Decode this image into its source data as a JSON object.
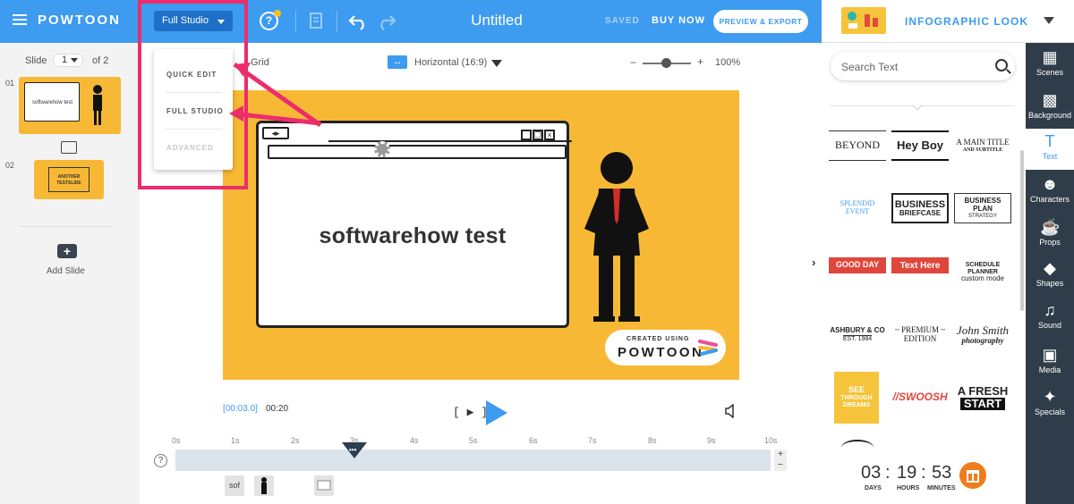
{
  "topbar": {
    "logo": "POWTOON",
    "mode_selected": "Full Studio",
    "title": "Untitled",
    "saved": "SAVED",
    "buy_now": "BUY NOW",
    "preview_export": "PREVIEW & EXPORT",
    "colors": {
      "bar": "#3d9bf0",
      "mode_button": "#1f6fc7",
      "highlight": "#ec2d6b"
    }
  },
  "mode_menu": {
    "items": [
      {
        "label": "QUICK EDIT",
        "enabled": true
      },
      {
        "label": "FULL STUDIO",
        "enabled": true
      },
      {
        "label": "ADVANCED",
        "enabled": false
      }
    ]
  },
  "style_bar": {
    "label": "INFOGRAPHIC LOOK"
  },
  "slides": {
    "label": "Slide",
    "current": "1",
    "of_text": "of 2",
    "items": [
      {
        "number": "01",
        "caption": "softwarehow test"
      },
      {
        "number": "02",
        "caption": "ANOTHER TESTSLIDE",
        "caption_line1": "ANOTHER",
        "caption_line2": "TESTSLIDE"
      }
    ],
    "add_slide": "Add Slide"
  },
  "canvas_toolbar": {
    "grid": "Grid",
    "orientation": "Horizontal (16:9)",
    "zoom": "100%",
    "zoom_minus": "−",
    "zoom_plus": "+",
    "zoom_level": 0.5
  },
  "stage": {
    "window_text": "softwarehow test",
    "badge_sub": "CREATED USING",
    "badge_main": "POWTOON",
    "background": "#f7b935"
  },
  "timeline": {
    "current_time": "[00:03.0]",
    "total_time": "00:20",
    "frame_button": "[ ▶ ]",
    "ticks": [
      "0s",
      "1s",
      "2s",
      "3s",
      "4s",
      "5s",
      "6s",
      "7s",
      "8s",
      "9s",
      "10s"
    ],
    "playhead_seconds": 3,
    "help": "?",
    "plus": "+",
    "minus": "−",
    "element_label": "sof"
  },
  "text_panel": {
    "search_placeholder": "Search Text",
    "items": [
      {
        "text": "BEYOND"
      },
      {
        "text": "Hey Boy"
      },
      {
        "text": "A MAIN TITLE",
        "sub": "AND SUBTITLE"
      },
      {
        "text": "SPLENDID EVENT"
      },
      {
        "text": "BUSINESS",
        "sub": "BRIEFCASE"
      },
      {
        "text": "BUSINESS PLAN",
        "sub": "STRATEGY"
      },
      {
        "text": "GOOD DAY"
      },
      {
        "text": "Text Here"
      },
      {
        "text": "SCHEDULE PLANNER",
        "sub": "custom mode"
      },
      {
        "text": "ASHBURY & CO",
        "sub": "EST. 1984"
      },
      {
        "text": "~ PREMIUM ~",
        "sub": "EDITION"
      },
      {
        "text": "John Smith",
        "sub": "photography"
      },
      {
        "text": "SEE",
        "sub": "THROUGH DREAMS"
      },
      {
        "text": "//SWOOSH"
      },
      {
        "text": "A FRESH",
        "sub": "START"
      }
    ]
  },
  "countdown": {
    "days": "03",
    "hours": "19",
    "minutes": "53",
    "days_label": "DAYS",
    "hours_label": "HOURS",
    "minutes_label": "MINUTES",
    "sep": ":"
  },
  "dark_sidebar": {
    "items": [
      {
        "label": "Scenes",
        "icon": "scenes-icon",
        "glyph": "▦"
      },
      {
        "label": "Background",
        "icon": "background-icon",
        "glyph": "▩"
      },
      {
        "label": "Text",
        "icon": "text-icon",
        "glyph": "T"
      },
      {
        "label": "Characters",
        "icon": "characters-icon",
        "glyph": "☻"
      },
      {
        "label": "Props",
        "icon": "props-icon",
        "glyph": "☕"
      },
      {
        "label": "Shapes",
        "icon": "shapes-icon",
        "glyph": "◆"
      },
      {
        "label": "Sound",
        "icon": "sound-icon",
        "glyph": "♫"
      },
      {
        "label": "Media",
        "icon": "media-icon",
        "glyph": "▣"
      },
      {
        "label": "Specials",
        "icon": "specials-icon",
        "glyph": "✦"
      }
    ],
    "active": "Text"
  }
}
